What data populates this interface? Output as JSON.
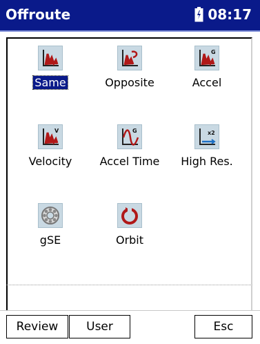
{
  "titlebar": {
    "title": "Offroute",
    "clock": "08:17",
    "battery_icon": "battery-icon"
  },
  "tiles": [
    {
      "label": "Same",
      "icon": "same-chart-icon",
      "selected": true
    },
    {
      "label": "Opposite",
      "icon": "opposite-chart-icon"
    },
    {
      "label": "Accel",
      "icon": "accel-chart-icon",
      "badge": "G"
    },
    {
      "label": "Velocity",
      "icon": "velocity-chart-icon",
      "badge": "V"
    },
    {
      "label": "Accel Time",
      "icon": "accel-time-wave-icon",
      "badge": "G"
    },
    {
      "label": "High Res.",
      "icon": "high-res-chart-icon",
      "badge": "x2"
    },
    {
      "label": "gSE",
      "icon": "bearing-icon"
    },
    {
      "label": "Orbit",
      "icon": "orbit-icon"
    }
  ],
  "buttons": {
    "review": "Review",
    "user": "User",
    "esc": "Esc"
  },
  "colors": {
    "titlebar": "#0a1a8a",
    "selection": "#0a1a8a",
    "chart_red": "#b01818",
    "icon_bg": "#c9d9e3"
  }
}
